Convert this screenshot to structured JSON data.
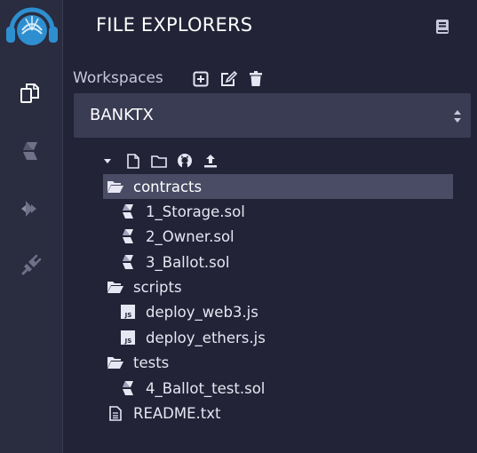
{
  "panel": {
    "title": "FILE EXPLORERS"
  },
  "workspaces": {
    "label": "Workspaces",
    "selected": "BANKTX"
  },
  "tree": {
    "items": [
      {
        "label": "contracts",
        "icon": "folder-open-icon",
        "depth": 0,
        "selected": true
      },
      {
        "label": "1_Storage.sol",
        "icon": "solidity-file-icon",
        "depth": 1
      },
      {
        "label": "2_Owner.sol",
        "icon": "solidity-file-icon",
        "depth": 1
      },
      {
        "label": "3_Ballot.sol",
        "icon": "solidity-file-icon",
        "depth": 1
      },
      {
        "label": "scripts",
        "icon": "folder-open-icon",
        "depth": 0
      },
      {
        "label": "deploy_web3.js",
        "icon": "js-file-icon",
        "depth": 1
      },
      {
        "label": "deploy_ethers.js",
        "icon": "js-file-icon",
        "depth": 1
      },
      {
        "label": "tests",
        "icon": "folder-open-icon",
        "depth": 0
      },
      {
        "label": "4_Ballot_test.sol",
        "icon": "solidity-file-icon",
        "depth": 1
      },
      {
        "label": "README.txt",
        "icon": "text-file-icon",
        "depth": 0
      }
    ]
  },
  "icons": {
    "iconbar": [
      "remix-logo-icon",
      "file-explorer-icon",
      "solidity-compiler-icon",
      "deploy-run-icon",
      "plugin-manager-icon"
    ],
    "workspace_actions": [
      "add-workspace-icon",
      "rename-workspace-icon",
      "delete-workspace-icon"
    ],
    "tree_actions": [
      "caret-down-icon",
      "new-file-icon",
      "new-folder-icon",
      "github-icon",
      "upload-icon"
    ]
  },
  "colors": {
    "background": "#222336",
    "iconbar": "#2a2c3f",
    "select_bg": "#3a3c54",
    "selected_row": "#4a4c65",
    "logo": "#2e8fd0"
  }
}
